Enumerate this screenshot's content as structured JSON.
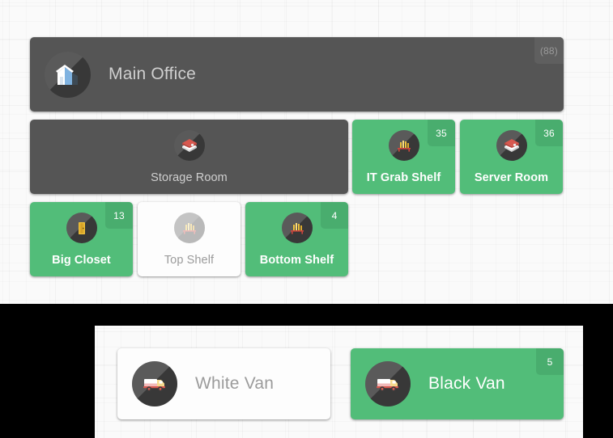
{
  "theme": {
    "green": "#52bd79",
    "green_badge": "#49ad6e",
    "dark_card": "#555555",
    "dark_badge": "#5f5f5f",
    "white_card": "#fdfdfd",
    "background": "#fafafa",
    "divider_black": "#000000"
  },
  "top_panel": {
    "header": {
      "label": "Main Office",
      "count": "(88)",
      "icon": "office-building-icon",
      "state": "dark"
    },
    "rows": [
      {
        "cards": [
          {
            "label": "Storage Room",
            "count": "",
            "icon": "storage-box-icon",
            "state": "dark",
            "layout": "column"
          },
          {
            "label": "IT Grab Shelf",
            "count": "35",
            "icon": "shelf-rack-icon",
            "state": "green",
            "layout": "column"
          },
          {
            "label": "Server Room",
            "count": "36",
            "icon": "storage-box-icon",
            "state": "green",
            "layout": "column"
          }
        ]
      },
      {
        "cards": [
          {
            "label": "Big Closet",
            "count": "13",
            "icon": "closet-door-icon",
            "state": "green",
            "layout": "column"
          },
          {
            "label": "Top Shelf",
            "count": "",
            "icon": "shelf-rack-icon",
            "state": "white",
            "layout": "column"
          },
          {
            "label": "Bottom Shelf",
            "count": "4",
            "icon": "shelf-rack-icon",
            "state": "green",
            "layout": "column"
          }
        ]
      }
    ]
  },
  "bottom_panel": {
    "cards": [
      {
        "label": "White Van",
        "count": "",
        "icon": "delivery-van-icon",
        "state": "white",
        "layout": "row"
      },
      {
        "label": "Black Van",
        "count": "5",
        "icon": "delivery-van-icon",
        "state": "green",
        "layout": "row"
      }
    ]
  }
}
